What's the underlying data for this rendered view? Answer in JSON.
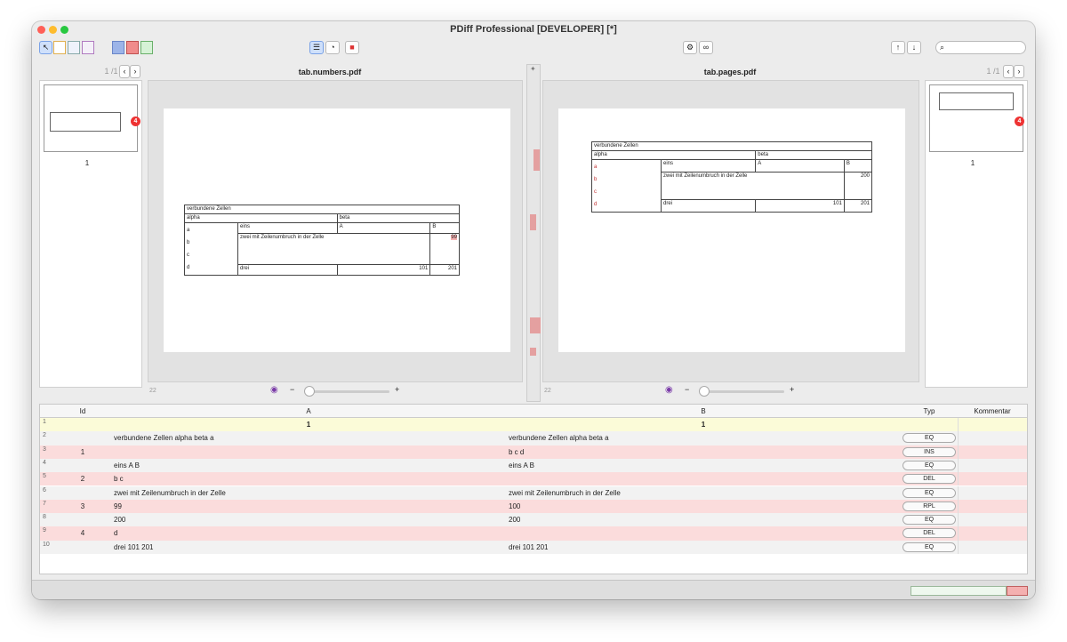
{
  "window": {
    "title": "PDiff Professional [DEVELOPER] [*]",
    "colors": {
      "close": "#ff5f57",
      "minimize": "#febc2e",
      "zoom": "#28c840"
    }
  },
  "toolbar": {
    "search_placeholder": "",
    "search_icon": "magnifier-icon",
    "settings_icon": "gear-icon",
    "link_icon": "link-icon",
    "prev_icon": "arrow-up-icon",
    "next_icon": "arrow-down-icon"
  },
  "left": {
    "filename": "tab.numbers.pdf",
    "page_counter": "1 /1",
    "thumb_page_label": "1",
    "badge": "4",
    "page_footer": "22",
    "table": {
      "header": "verbundene Zellen",
      "alpha": "alpha",
      "beta": "beta",
      "row_letters": [
        "a",
        "b",
        "c",
        "d"
      ],
      "eins": "eins",
      "A": "A",
      "B": "B",
      "zwei": "zwei mit Zeilenumbruch in der Zelle",
      "n99": "99",
      "n200": "200",
      "drei": "drei",
      "n101": "101",
      "n201": "201"
    }
  },
  "right": {
    "filename": "tab.pages.pdf",
    "page_counter": "1 /1",
    "thumb_page_label": "1",
    "badge": "4",
    "page_footer": "22",
    "table": {
      "header": "verbundene Zellen",
      "alpha": "alpha",
      "beta": "beta",
      "row_letters": [
        "a",
        "b",
        "c",
        "d"
      ],
      "eins": "eins",
      "A": "A",
      "B": "B",
      "zwei": "zwei mit Zeilenumbruch in der Zelle",
      "n100": "100",
      "n200": "200",
      "drei": "drei",
      "n101": "101",
      "n201": "201"
    }
  },
  "grid": {
    "columns": {
      "id": "Id",
      "a": "A",
      "b": "B",
      "typ": "Typ",
      "kommentar": "Kommentar"
    },
    "rows": [
      {
        "n": "1",
        "id": "",
        "a": "1",
        "b": "1",
        "typ": "",
        "kind": "page"
      },
      {
        "n": "2",
        "id": "",
        "a": "verbundene Zellen alpha beta a",
        "b": "verbundene Zellen alpha beta a",
        "typ": "EQ",
        "kind": "eq"
      },
      {
        "n": "3",
        "id": "1",
        "a": "",
        "b": "b c d",
        "typ": "INS",
        "kind": "diff"
      },
      {
        "n": "4",
        "id": "",
        "a": "eins A B",
        "b": "eins A B",
        "typ": "EQ",
        "kind": "eq"
      },
      {
        "n": "5",
        "id": "2",
        "a": "b c",
        "b": "",
        "typ": "DEL",
        "kind": "diff"
      },
      {
        "n": "6",
        "id": "",
        "a": "zwei mit Zeilenumbruch in der Zelle",
        "b": "zwei mit Zeilenumbruch in der Zelle",
        "typ": "EQ",
        "kind": "eq"
      },
      {
        "n": "7",
        "id": "3",
        "a": "99",
        "b": "100",
        "typ": "RPL",
        "kind": "diff"
      },
      {
        "n": "8",
        "id": "",
        "a": "200",
        "b": "200",
        "typ": "EQ",
        "kind": "eq"
      },
      {
        "n": "9",
        "id": "4",
        "a": "d",
        "b": "",
        "typ": "DEL",
        "kind": "diff"
      },
      {
        "n": "10",
        "id": "",
        "a": "drei 101 201",
        "b": "drei 101 201",
        "typ": "EQ",
        "kind": "eq"
      }
    ],
    "colors": {
      "page": "#fbfbd8",
      "diff": "#fbdcdc",
      "eq": "#f2f2f2"
    }
  }
}
